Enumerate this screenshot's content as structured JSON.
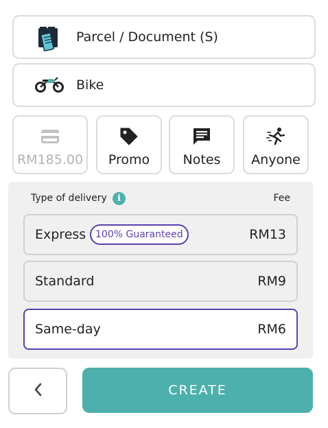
{
  "parcel": {
    "label": "Parcel / Document (S)",
    "icon": "parcel-box-icon"
  },
  "vehicle": {
    "label": "Bike",
    "icon": "motorbike-icon"
  },
  "options": [
    {
      "label": "RM185.00",
      "icon": "credit-card-icon",
      "disabled": true
    },
    {
      "label": "Promo",
      "icon": "tag-icon",
      "disabled": false
    },
    {
      "label": "Notes",
      "icon": "chat-icon",
      "disabled": false
    },
    {
      "label": "Anyone",
      "icon": "runner-icon",
      "disabled": false
    }
  ],
  "delivery": {
    "header_left": "Type of delivery",
    "header_right": "Fee",
    "info_icon": "info-icon",
    "options": [
      {
        "name": "Express",
        "badge": "100% Guaranteed",
        "fee": "RM13",
        "selected": false
      },
      {
        "name": "Standard",
        "fee": "RM9",
        "selected": false
      },
      {
        "name": "Same-day",
        "fee": "RM6",
        "selected": true
      }
    ]
  },
  "actions": {
    "back_icon": "chevron-left-icon",
    "create_label": "CREATE"
  },
  "colors": {
    "accent": "#4db0ac",
    "selected_border": "#5b3fb0",
    "panel_bg": "#f0f0f0",
    "disabled_text": "#b3b3b3"
  }
}
